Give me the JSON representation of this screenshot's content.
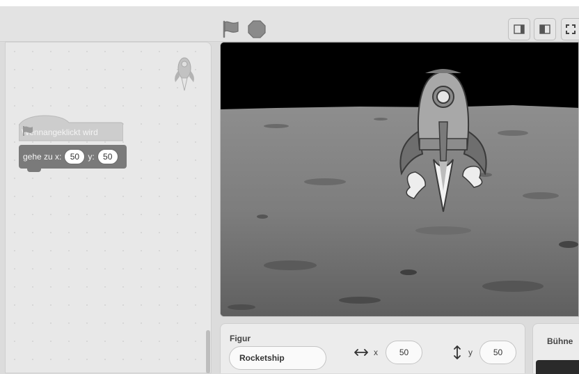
{
  "code_area": {
    "hat_block_label": "Wenn",
    "hat_block_suffix": "angeklickt wird",
    "motion_block_label": "gehe zu x:",
    "motion_block_y_label": "y:",
    "motion_block_x_value": "50",
    "motion_block_y_value": "50"
  },
  "sprite_info": {
    "section_label": "Figur",
    "sprite_name": "Rocketship",
    "x_label": "x",
    "x_value": "50",
    "y_label": "y",
    "y_value": "50"
  },
  "stage_panel": {
    "label": "Bühne"
  },
  "icons": {
    "green_flag": "flag-icon",
    "stop": "stop-icon",
    "small_stage": "small-stage-icon",
    "large_stage": "large-stage-icon",
    "fullscreen": "fullscreen-icon"
  }
}
